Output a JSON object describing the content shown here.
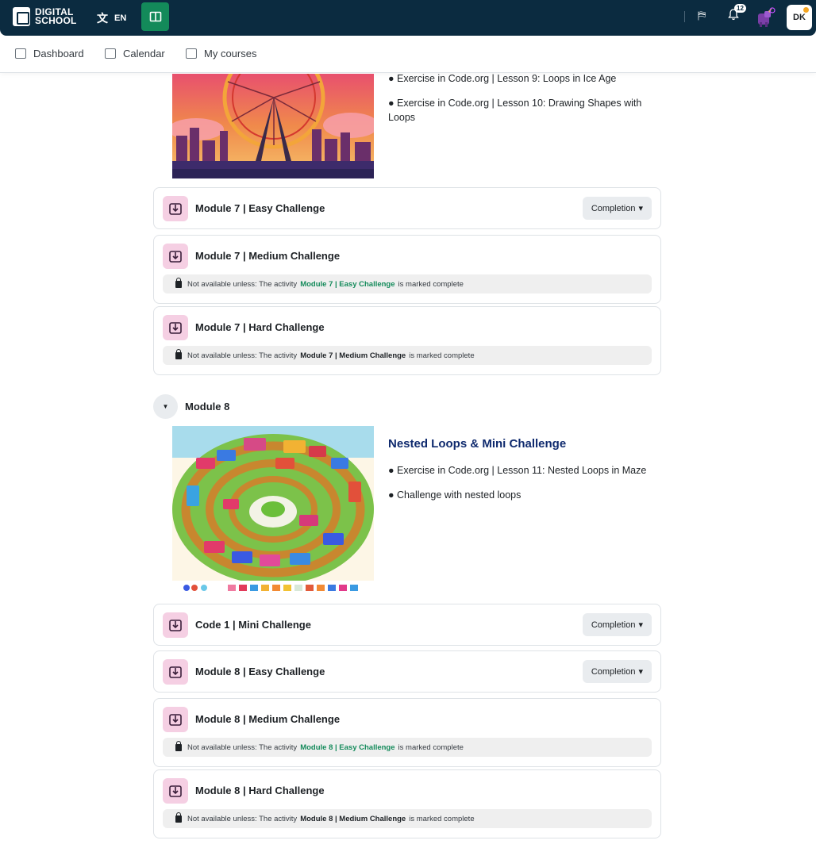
{
  "header": {
    "logo_line1": "DIGITAL",
    "logo_line2": "SCHOOL",
    "language": "EN",
    "notification_count": "12",
    "user_initials": "DK"
  },
  "nav": {
    "dashboard": "Dashboard",
    "calendar": "Calendar",
    "my_courses": "My courses"
  },
  "module7": {
    "descriptions": [
      "● Exercise in Code.org | Lesson 9: Loops in Ice Age",
      "● Exercise in Code.org | Lesson 10: Drawing Shapes with",
      "Loops"
    ],
    "activities": [
      {
        "title": "Module 7 | Easy Challenge",
        "completion": "Completion"
      },
      {
        "title": "Module 7 | Medium Challenge"
      },
      {
        "title": "Module 7 | Hard Challenge"
      }
    ]
  },
  "module8": {
    "heading": "Module 8",
    "title": "Nested Loops & Mini Challenge",
    "descriptions": [
      "● Exercise in Code.org | Lesson 11: Nested Loops in Maze",
      "● Challenge with nested loops"
    ],
    "activities": [
      {
        "title": "Code 1 | Mini Challenge",
        "completion": "Completion"
      },
      {
        "title": "Module 8 | Easy Challenge",
        "completion": "Completion"
      },
      {
        "title": "Module 8 | Medium Challenge"
      },
      {
        "title": "Module 8 | Hard Challenge"
      }
    ]
  },
  "restriction": {
    "prefix": "Not available unless: The activity",
    "suffix": "is marked complete",
    "m7_medium_req": "Module 7 | Easy Challenge",
    "m7_hard_req": "Module 7 | Medium Challenge",
    "m8_medium_req": "Module 8 | Easy Challenge",
    "m8_hard_req": "Module 8 | Medium Challenge"
  },
  "colors": {
    "topbar": "#0b2b40",
    "accent_green": "#138a5a",
    "activity_icon_bg": "#f5cfe3",
    "section_title": "#0f2a6e"
  }
}
